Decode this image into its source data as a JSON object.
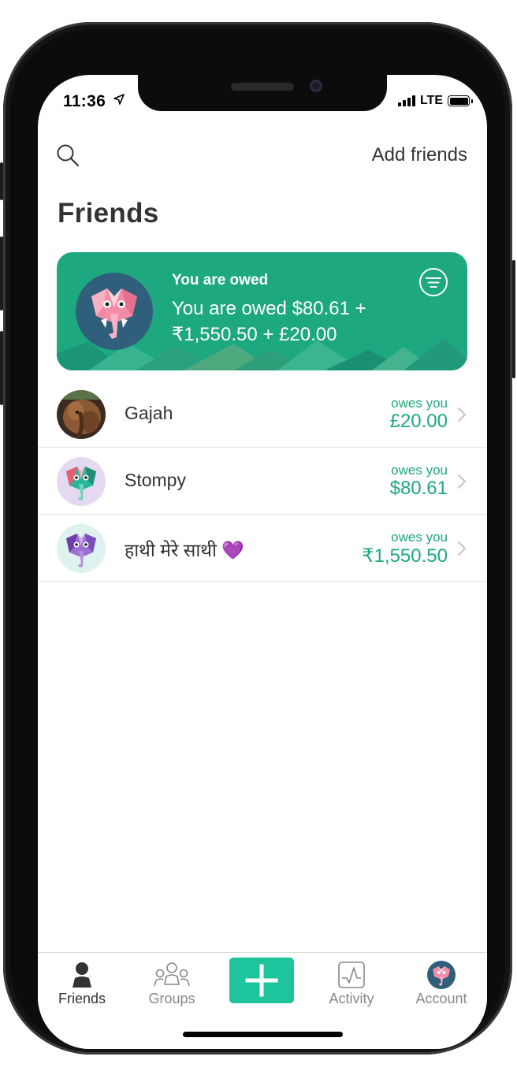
{
  "status_bar": {
    "time": "11:36",
    "network": "LTE"
  },
  "header": {
    "add_friends_label": "Add friends",
    "title": "Friends"
  },
  "summary": {
    "heading": "You are owed",
    "line1": "You are owed $80.61 +",
    "line2": "₹1,550.50 + £20.00",
    "card_color": "#1ea87f"
  },
  "friends": [
    {
      "name": "Gajah",
      "status": "owes you",
      "amount": "£20.00"
    },
    {
      "name": "Stompy",
      "status": "owes you",
      "amount": "$80.61"
    },
    {
      "name": "हाथी मेरे साथी 💜",
      "status": "owes you",
      "amount": "₹1,550.50"
    }
  ],
  "tab_bar": {
    "tabs": [
      {
        "label": "Friends",
        "icon": "person-icon",
        "active": true
      },
      {
        "label": "Groups",
        "icon": "group-icon",
        "active": false
      },
      {
        "label": "",
        "icon": "plus-icon",
        "active": false
      },
      {
        "label": "Activity",
        "icon": "activity-icon",
        "active": false
      },
      {
        "label": "Account",
        "icon": "account-avatar",
        "active": false
      }
    ],
    "accent_color": "#1ec49b"
  }
}
